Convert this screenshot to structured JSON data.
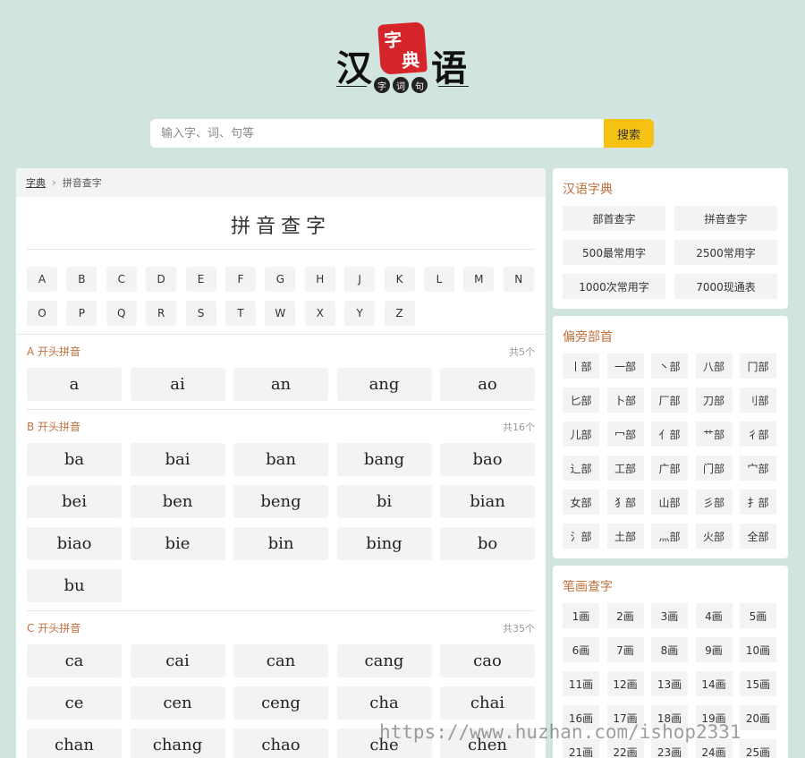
{
  "logo": {
    "left": "汉",
    "right": "语",
    "seal_top": "字",
    "seal_bottom": "典",
    "sub": [
      "字",
      "词",
      "句"
    ]
  },
  "search": {
    "placeholder": "输入字、词、句等",
    "button": "搜索"
  },
  "breadcrumb": {
    "home": "字典",
    "current": "拼音查字"
  },
  "page_title": "拼音查字",
  "letters": [
    "A",
    "B",
    "C",
    "D",
    "E",
    "F",
    "G",
    "H",
    "J",
    "K",
    "L",
    "M",
    "N",
    "O",
    "P",
    "Q",
    "R",
    "S",
    "T",
    "W",
    "X",
    "Y",
    "Z"
  ],
  "sections": [
    {
      "title": "A 开头拼音",
      "count": "共5个",
      "items": [
        "a",
        "ai",
        "an",
        "ang",
        "ao"
      ]
    },
    {
      "title": "B 开头拼音",
      "count": "共16个",
      "items": [
        "ba",
        "bai",
        "ban",
        "bang",
        "bao",
        "bei",
        "ben",
        "beng",
        "bi",
        "bian",
        "biao",
        "bie",
        "bin",
        "bing",
        "bo",
        "bu"
      ]
    },
    {
      "title": "C 开头拼音",
      "count": "共35个",
      "items": [
        "ca",
        "cai",
        "can",
        "cang",
        "cao",
        "ce",
        "cen",
        "ceng",
        "cha",
        "chai",
        "chan",
        "chang",
        "chao",
        "che",
        "chen"
      ]
    }
  ],
  "dict_panel": {
    "title": "汉语字典",
    "items": [
      "部首查字",
      "拼音查字",
      "500最常用字",
      "2500常用字",
      "1000次常用字",
      "7000现通表"
    ]
  },
  "radical_panel": {
    "title": "偏旁部首",
    "items": [
      "丨部",
      "一部",
      "丶部",
      "八部",
      "冂部",
      "匕部",
      "卜部",
      "厂部",
      "刀部",
      "刂部",
      "儿部",
      "冖部",
      "亻部",
      "艹部",
      "彳部",
      "辶部",
      "工部",
      "广部",
      "门部",
      "宀部",
      "女部",
      "犭部",
      "山部",
      "彡部",
      "扌部",
      "氵部",
      "土部",
      "灬部",
      "火部",
      "全部"
    ]
  },
  "stroke_panel": {
    "title": "笔画查字",
    "items": [
      "1画",
      "2画",
      "3画",
      "4画",
      "5画",
      "6画",
      "7画",
      "8画",
      "9画",
      "10画",
      "11画",
      "12画",
      "13画",
      "14画",
      "15画",
      "16画",
      "17画",
      "18画",
      "19画",
      "20画",
      "21画",
      "22画",
      "23画",
      "24画",
      "25画"
    ]
  },
  "watermark": "https://www.huzhan.com/ishop2331"
}
